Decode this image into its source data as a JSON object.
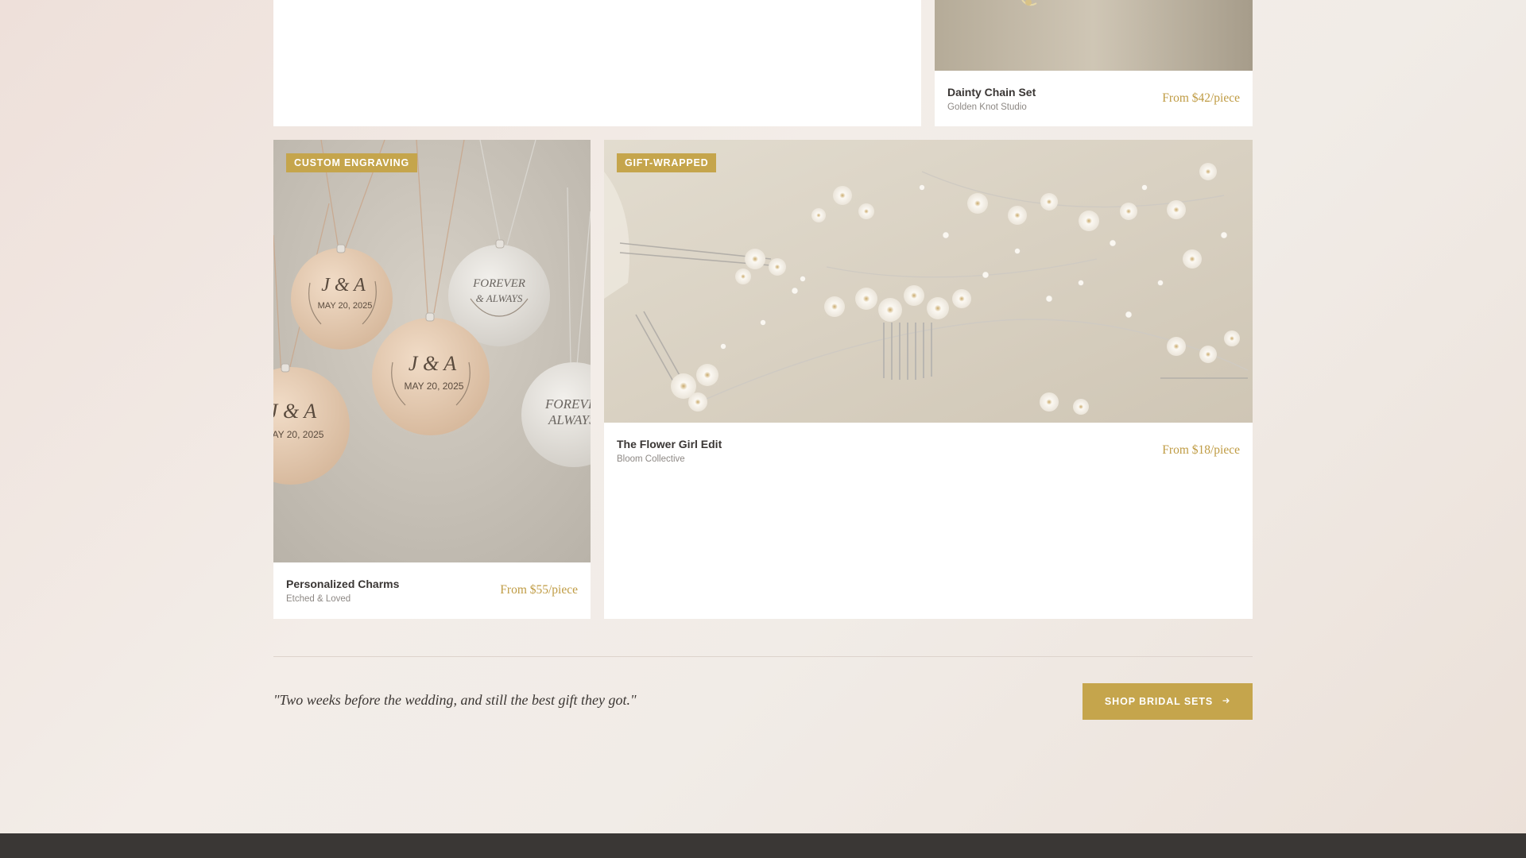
{
  "products": [
    {
      "title": "Dainty Chain Set",
      "maker": "Golden Knot Studio",
      "price": "From $42/piece"
    },
    {
      "badge": "CUSTOM ENGRAVING",
      "title": "Personalized Charms",
      "maker": "Etched & Loved",
      "price": "From $55/piece",
      "charm_texts": {
        "initials": "J & A",
        "date": "MAY 20, 2025",
        "motto_line1": "FOREVER",
        "motto_line2": "& ALWAYS",
        "motto_alt_line1": "FOREVER",
        "motto_alt_line2": "ALWAYS"
      }
    },
    {
      "badge": "GIFT-WRAPPED",
      "title": "The Flower Girl Edit",
      "maker": "Bloom Collective",
      "price": "From $18/piece"
    }
  ],
  "testimonial": {
    "quote": "\"Two weeks before the wedding, and still the best gift they got.\""
  },
  "cta": {
    "label": "SHOP BRIDAL SETS",
    "icon": "arrow-right-icon"
  },
  "colors": {
    "accent": "#c5a54c",
    "price": "#bf9b43",
    "footer": "#3a3735"
  }
}
